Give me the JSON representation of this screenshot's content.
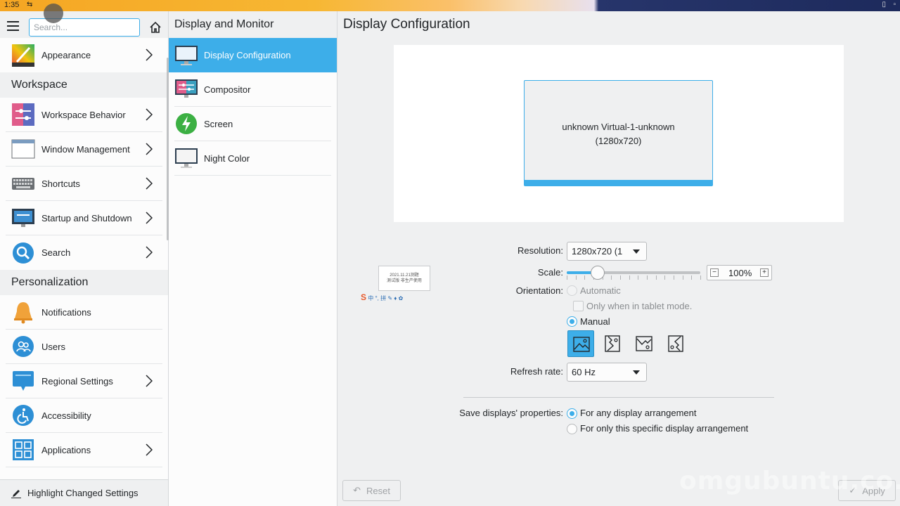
{
  "system": {
    "clock": "1:35"
  },
  "sidebar": {
    "search_placeholder": "Search...",
    "items_top": [
      {
        "label": "Appearance",
        "icon": "appearance-icon"
      }
    ],
    "workspace": {
      "title": "Workspace",
      "items": [
        {
          "label": "Workspace Behavior",
          "icon": "workspace-behavior-icon"
        },
        {
          "label": "Window Management",
          "icon": "window-management-icon"
        },
        {
          "label": "Shortcuts",
          "icon": "keyboard-icon"
        },
        {
          "label": "Startup and Shutdown",
          "icon": "startup-icon"
        },
        {
          "label": "Search",
          "icon": "search-icon"
        }
      ]
    },
    "personalization": {
      "title": "Personalization",
      "items": [
        {
          "label": "Notifications",
          "icon": "bell-icon"
        },
        {
          "label": "Users",
          "icon": "users-icon"
        },
        {
          "label": "Regional Settings",
          "icon": "regional-icon"
        },
        {
          "label": "Accessibility",
          "icon": "accessibility-icon"
        },
        {
          "label": "Applications",
          "icon": "applications-icon"
        }
      ]
    },
    "footer_label": "Highlight Changed Settings"
  },
  "subnav": {
    "title": "Display and Monitor",
    "items": [
      {
        "label": "Display Configuration",
        "active": true
      },
      {
        "label": "Compositor",
        "active": false
      },
      {
        "label": "Screen",
        "active": false
      },
      {
        "label": "Night Color",
        "active": false
      }
    ]
  },
  "main": {
    "title": "Display Configuration",
    "monitor_name": "unknown Virtual-1-unknown",
    "monitor_res": "(1280x720)",
    "resolution_label": "Resolution:",
    "resolution_value": "1280x720 (1",
    "scale_label": "Scale:",
    "scale_value": "100%",
    "scale_fraction": 0.23,
    "orientation_label": "Orientation:",
    "opt_automatic": "Automatic",
    "opt_tablet": "Only when in tablet mode.",
    "opt_manual": "Manual",
    "refresh_label": "Refresh rate:",
    "refresh_value": "60 Hz",
    "save_label": "Save displays' properties:",
    "save_opt1": "For any display arrangement",
    "save_opt2": "For only this specific display arrangement",
    "reset_label": "Reset",
    "apply_label": "Apply"
  },
  "ime": {
    "line1": "2021.11.21测题",
    "line2": "测试版 非生产使用",
    "bar": "中 °, 拼 ✎ ♦ ✿"
  },
  "watermark": "omgubuntu.co.uk",
  "colors": {
    "accent": "#3daee9",
    "background": "#eff0f1",
    "panel": "#fcfcfc"
  }
}
